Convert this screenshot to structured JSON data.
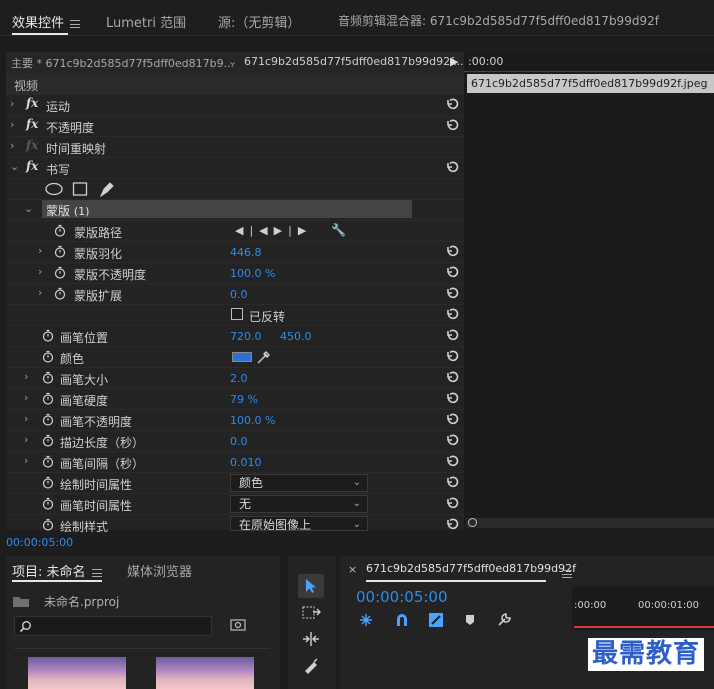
{
  "tabs": {
    "effect_controls": "效果控件",
    "lumetri": "Lumetri 范围",
    "source": "源:（无剪辑）",
    "audio_mixer": "音频剪辑混合器: 671c9b2d585d77f5dff0ed817b99d92f"
  },
  "ec": {
    "master_label": "主要 * 671c9b2d585d77f5dff0ed817b9...",
    "clip_selector": "671c9b2d585d77f5dff0ed817b99d92f...",
    "time_zero": ":00:00",
    "clip_name": "671c9b2d585d77f5dff0ed817b99d92f.jpeg",
    "video_header": "视频",
    "motion": "运动",
    "opacity": "不透明度",
    "time_remap": "时间重映射",
    "write": "书写",
    "mask_label": "蒙版",
    "mask_count": "(1)",
    "mask_path": "蒙版路径",
    "mask_feather": "蒙版羽化",
    "mask_feather_val": "446.8",
    "mask_opacity": "蒙版不透明度",
    "mask_opacity_val": "100.0 %",
    "mask_expand": "蒙版扩展",
    "mask_expand_val": "0.0",
    "inverted": "已反转",
    "brush_position": "画笔位置",
    "brush_position_x": "720.0",
    "brush_position_y": "450.0",
    "color": "颜色",
    "color_swatch": "#2f6fd0",
    "brush_size": "画笔大小",
    "brush_size_val": "2.0",
    "brush_hardness": "画笔硬度",
    "brush_hardness_val": "79 %",
    "brush_opacity": "画笔不透明度",
    "brush_opacity_val": "100.0 %",
    "stroke_length": "描边长度（秒）",
    "stroke_length_val": "0.0",
    "brush_spacing": "画笔间隔（秒）",
    "brush_spacing_val": "0.010",
    "paint_time_prop1": "绘制时间属性",
    "paint_time_prop1_val": "颜色",
    "paint_time_prop2": "画笔时间属性",
    "paint_time_prop2_val": "无",
    "paint_style": "绘制样式",
    "paint_style_val": "在原始图像上"
  },
  "timecode": "00:00:05:00",
  "project": {
    "title": "项目: 未命名",
    "media_browser": "媒体浏览器",
    "file": "未命名.prproj"
  },
  "sequence": {
    "name": "671c9b2d585d77f5dff0ed817b99d92f",
    "timecode": "00:00:05:00",
    "ruler_0": ":00:00",
    "ruler_1": "00:00:01:00"
  },
  "watermark": "最需教育"
}
